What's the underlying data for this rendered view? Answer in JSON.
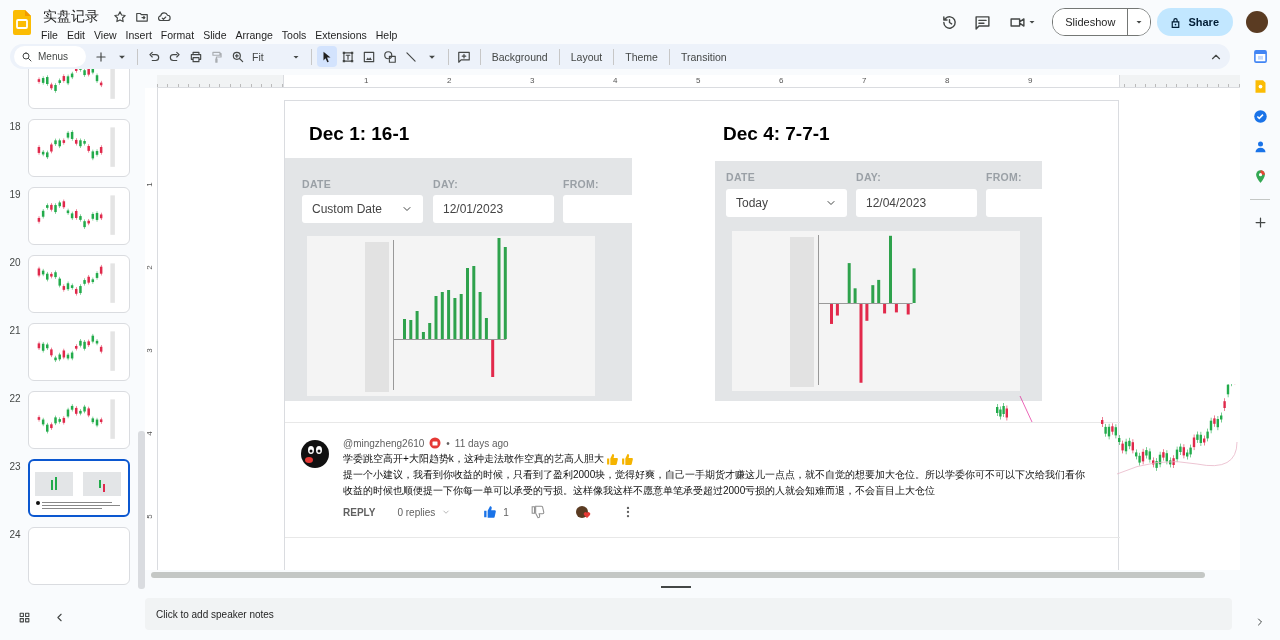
{
  "document": {
    "title": "实盘记录"
  },
  "menu_bar": [
    "File",
    "Edit",
    "View",
    "Insert",
    "Format",
    "Slide",
    "Arrange",
    "Tools",
    "Extensions",
    "Help"
  ],
  "header_actions": {
    "slideshow": "Slideshow",
    "share": "Share"
  },
  "toolbar": {
    "search": {
      "placeholder": "Menus"
    },
    "zoom": "Fit",
    "edit_actions": [
      {
        "kind": "undo",
        "disabled": false
      },
      {
        "kind": "redo",
        "disabled": false
      },
      {
        "kind": "print",
        "disabled": false
      },
      {
        "kind": "paint_format",
        "disabled": true
      }
    ],
    "tools": [
      {
        "kind": "select",
        "selected": true
      },
      {
        "kind": "text_box",
        "selected": false
      },
      {
        "kind": "image",
        "selected": false
      },
      {
        "kind": "shape",
        "selected": false
      },
      {
        "kind": "line",
        "selected": false
      }
    ],
    "buttons": [
      "Background",
      "Layout",
      "Theme",
      "Transition"
    ]
  },
  "rulers": {
    "horizontal": [
      "1",
      "2",
      "3",
      "4",
      "5",
      "6",
      "7",
      "8",
      "9"
    ],
    "vertical": [
      "1",
      "2",
      "3",
      "4",
      "5"
    ]
  },
  "filmstrip": {
    "slides": [
      {
        "kind": "candles",
        "selected": false
      },
      {
        "number": "18",
        "kind": "candles",
        "selected": false
      },
      {
        "number": "19",
        "kind": "candles",
        "selected": false
      },
      {
        "number": "20",
        "kind": "candles",
        "selected": false
      },
      {
        "number": "21",
        "kind": "candles",
        "selected": false
      },
      {
        "number": "22",
        "kind": "candles",
        "selected": false
      },
      {
        "number": "23",
        "kind": "summary",
        "selected": true
      },
      {
        "number": "24",
        "kind": "blank",
        "selected": false
      }
    ]
  },
  "slide": {
    "panels": [
      {
        "title": "Dec 1: 16-1",
        "fields": [
          {
            "kind": "select",
            "label": "DATE",
            "value": "Custom Date"
          },
          {
            "kind": "text",
            "label": "DAY:",
            "value": "12/01/2023"
          },
          {
            "kind": "text",
            "label": "FROM:"
          }
        ]
      },
      {
        "title": "Dec 4: 7-7-1",
        "fields": [
          {
            "kind": "select",
            "label": "DATE",
            "value": "Today"
          },
          {
            "kind": "text",
            "label": "DAY:",
            "value": "12/04/2023"
          },
          {
            "kind": "text",
            "label": "FROM:"
          }
        ]
      }
    ],
    "comment": {
      "author": "@mingzheng2610",
      "separator": "•",
      "time": "11 days ago",
      "lines": [
        "学委跳空高开+大阳趋势k，这种走法敢作空真的艺高人胆大",
        "提一个小建议，我看到你收益的时候，只看到了盈利2000块，觉得好爽，自己一手期货才赚这儿一点点，就不自觉的想要加大仓位。所以学委你可不可以下次给我们看你收益的时候也顺便提一下你每一单可以承受的亏损。这样像我这样不愿意单笔承受超过2000亏损的人就会知难而退，不会盲目上大仓位"
      ],
      "reply": "REPLY",
      "replies": "0 replies",
      "likes": "1"
    }
  },
  "speaker_notes": {
    "placeholder": "Click to add speaker notes"
  }
}
